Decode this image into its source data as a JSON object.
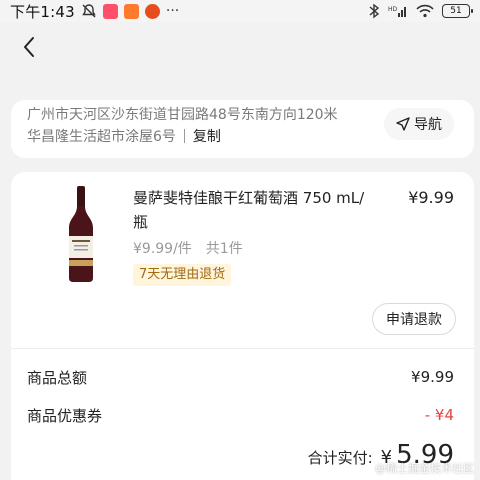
{
  "status_bar": {
    "time": "下午1:43",
    "battery": "51",
    "app_colors": [
      "#ff4f6a",
      "#ff7a2e",
      "#e74c1c"
    ]
  },
  "nav": {
    "back_icon": "chevron-left-icon"
  },
  "address": {
    "line1": "广州市天河区沙东街道甘园路48号东南方向120米",
    "line2": "华昌隆生活超市涂屋6号",
    "copy_label": "复制",
    "navigate_label": "导航",
    "navigate_icon": "navigation-arrow-icon"
  },
  "product": {
    "name": "曼萨斐特佳酿干红葡萄酒 750 mL/瓶",
    "price": "¥9.99",
    "unit_price": "¥9.99/件",
    "quantity": "共1件",
    "return_policy": "7天无理由退货",
    "refund_label": "申请退款",
    "image_icon": "wine-bottle-image"
  },
  "summary": {
    "total_label": "商品总额",
    "total_value": "¥9.99",
    "coupon_label": "商品优惠券",
    "coupon_value": "- ¥4",
    "pay_label": "合计实付:",
    "pay_currency": "¥",
    "pay_amount": "5.99"
  },
  "watermark": "@稀土掘金技术社区",
  "colors": {
    "accent_red": "#e8423f",
    "tag_bg": "#fff4dc",
    "tag_text": "#a26a12",
    "page_bg": "#f2f2f2"
  }
}
